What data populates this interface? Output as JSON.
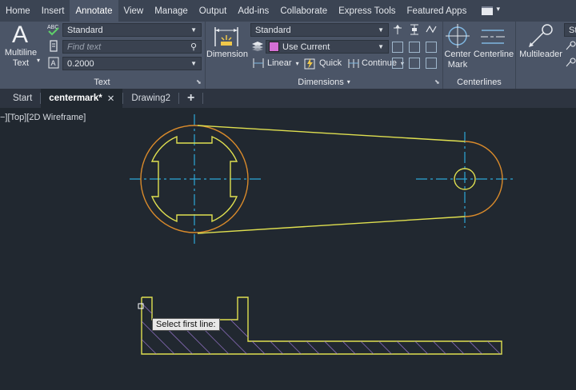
{
  "ribbon_tabs": [
    "Home",
    "Insert",
    "Annotate",
    "View",
    "Manage",
    "Output",
    "Add-ins",
    "Collaborate",
    "Express Tools",
    "Featured Apps"
  ],
  "active_tab": "Annotate",
  "text_panel": {
    "multiline_label_1": "Multiline",
    "multiline_label_2": "Text",
    "spellcheck_abc": "ABC",
    "style_value": "Standard",
    "find_placeholder": "Find text",
    "height_value": "0.2000",
    "panel_label": "Text"
  },
  "dimensions_panel": {
    "dimension_label": "Dimension",
    "style_value": "Standard",
    "layer_value": "Use Current",
    "layer_color": "#d46fd4",
    "linear_label": "Linear",
    "quick_label": "Quick",
    "continue_label": "Continue",
    "panel_label": "Dimensions"
  },
  "centerlines_panel": {
    "center_mark_label_1": "Center",
    "center_mark_label_2": "Mark",
    "centerline_label": "Centerline",
    "panel_label": "Centerlines"
  },
  "leaders_panel": {
    "multileader_label": "Multileader",
    "style_value": "Sta"
  },
  "document_tabs": [
    {
      "label": "Start",
      "active": false,
      "closable": false
    },
    {
      "label": "centermark*",
      "active": true,
      "closable": true
    },
    {
      "label": "Drawing2",
      "active": false,
      "closable": false
    }
  ],
  "new_tab_symbol": "+",
  "close_symbol": "✕",
  "viewport_controls": "−][Top][2D Wireframe]",
  "command_tooltip": "Select first line:",
  "colors": {
    "object_yellow": "#e0e050",
    "hidden_orange": "#d98a2b",
    "centerline_cyan": "#2ea8d8",
    "hatch_purple": "#a07ad8",
    "ribbon_bg": "#4b5567",
    "canvas_bg": "#212830"
  }
}
